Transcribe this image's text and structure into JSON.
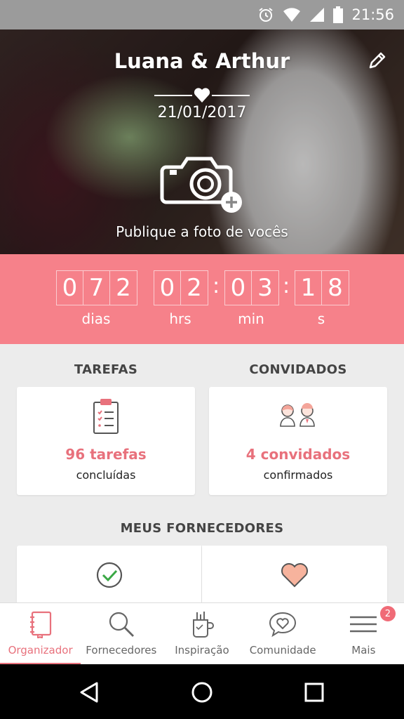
{
  "status_bar": {
    "time": "21:56",
    "icons": [
      "alarm-icon",
      "wifi-icon",
      "signal-icon",
      "battery-icon"
    ]
  },
  "hero": {
    "couple": "Luana & Arthur",
    "date": "21/01/2017",
    "caption": "Publique a foto de vocês"
  },
  "countdown": {
    "days": [
      "0",
      "7",
      "2"
    ],
    "hours": [
      "0",
      "2"
    ],
    "minutes": [
      "0",
      "3"
    ],
    "seconds": [
      "1",
      "8"
    ],
    "labels": {
      "days": "dias",
      "hours": "hrs",
      "minutes": "min",
      "seconds": "s"
    }
  },
  "tasks": {
    "title": "TAREFAS",
    "count": "96 tarefas",
    "status": "concluídas"
  },
  "guests": {
    "title": "CONVIDADOS",
    "count": "4 convidados",
    "status": "confirmados"
  },
  "vendors": {
    "title": "MEUS FORNECEDORES"
  },
  "nav": {
    "items": [
      {
        "label": "Organizador",
        "icon": "notebook-icon"
      },
      {
        "label": "Fornecedores",
        "icon": "search-icon"
      },
      {
        "label": "Inspiração",
        "icon": "cup-icon"
      },
      {
        "label": "Comunidade",
        "icon": "chat-heart-icon"
      },
      {
        "label": "Mais",
        "icon": "menu-icon"
      }
    ],
    "badge": "2"
  },
  "colors": {
    "accent": "#f6818a",
    "accent_text": "#e8717c",
    "background": "#ececec"
  }
}
